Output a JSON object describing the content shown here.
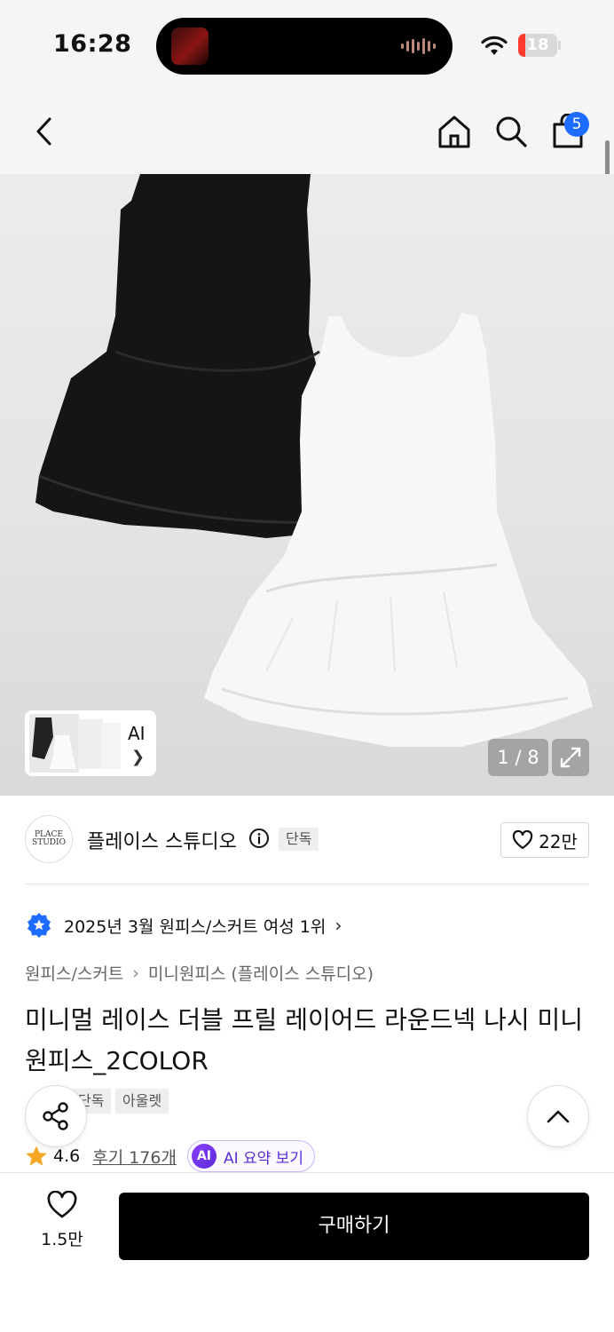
{
  "status_bar": {
    "time": "16:28",
    "battery_level": "18",
    "battery_fraction": 0.18
  },
  "nav": {
    "cart_count": "5"
  },
  "gallery": {
    "ai_label": "AI",
    "counter": "1 / 8"
  },
  "brand": {
    "logo_text": "PLACE STUDIO",
    "name": "플레이스 스튜디오",
    "tag": "단독",
    "fav_count": "22만"
  },
  "rank": {
    "text": "2025년 3월 원피스/스커트 여성 1위"
  },
  "breadcrumb": {
    "items": [
      "원피스/스커트",
      "미니원피스 (플레이스 스튜디오)"
    ]
  },
  "product": {
    "title": "미니멀 레이스 더블 프릴 레이어드 라운드넥 나시 미니원피스_2COLOR",
    "tags": [
      "단독",
      "아울렛"
    ]
  },
  "rating": {
    "value": "4.6",
    "review_link": "후기 176개",
    "ai_badge": "AI",
    "ai_summary": "AI 요약 보기"
  },
  "bottom": {
    "like_count": "1.5만",
    "buy_label": "구매하기"
  },
  "colors": {
    "accent_blue": "#1e6bff",
    "ai_purple": "#5b2bd9",
    "star": "#f5a623",
    "buy_button": "#000000"
  },
  "icons": [
    "back-icon",
    "home-icon",
    "search-icon",
    "cart-icon",
    "expand-icon",
    "info-icon",
    "heart-icon",
    "rank-badge-icon",
    "share-icon",
    "chevron-up-icon",
    "star-icon"
  ]
}
